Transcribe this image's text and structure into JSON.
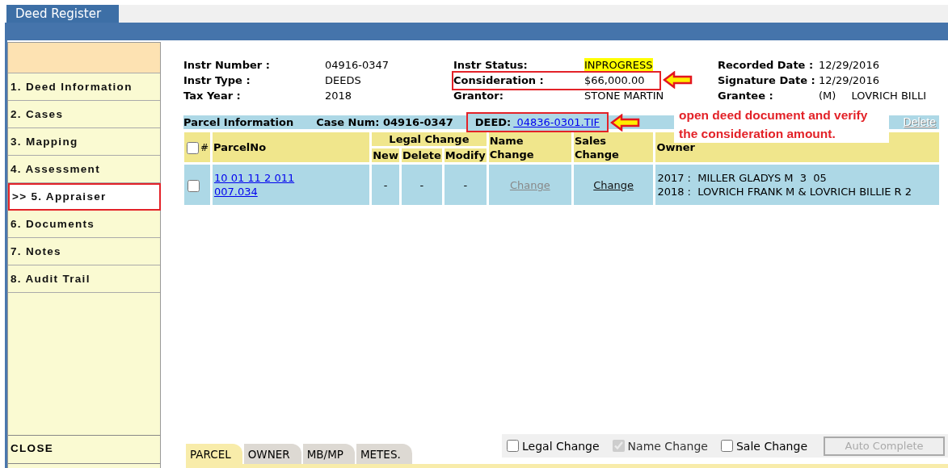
{
  "window": {
    "title": "Deed Register"
  },
  "sidebar": {
    "items": [
      {
        "label": "1. Deed Information",
        "selected": false
      },
      {
        "label": "2. Cases",
        "selected": false
      },
      {
        "label": "3. Mapping",
        "selected": false
      },
      {
        "label": "4. Assessment",
        "selected": false
      },
      {
        "label": ">> 5. Appraiser",
        "selected": true
      },
      {
        "label": "6. Documents",
        "selected": false
      },
      {
        "label": "7. Notes",
        "selected": false
      },
      {
        "label": "8. Audit Trail",
        "selected": false
      }
    ],
    "close": "CLOSE"
  },
  "instrument": {
    "columns": [
      [
        {
          "label": "Instr Number :",
          "value": "04916-0347",
          "highlighted": false,
          "callout": false
        },
        {
          "label": "Instr Type :",
          "value": "DEEDS",
          "highlighted": false,
          "callout": false
        },
        {
          "label": "Tax Year :",
          "value": "2018",
          "highlighted": false,
          "callout": false
        }
      ],
      [
        {
          "label": "Instr Status:",
          "value": "INPROGRESS",
          "highlighted": true,
          "callout": false
        },
        {
          "label": "Consideration :",
          "value": "$66,000.00",
          "highlighted": false,
          "callout": true
        },
        {
          "label": "Grantor:",
          "value": "STONE MARTIN",
          "highlighted": false,
          "callout": false
        }
      ],
      [
        {
          "label": "Recorded Date :",
          "value": "12/29/2016",
          "highlighted": false,
          "callout": false
        },
        {
          "label": "Signature Date :",
          "value": "12/29/2016",
          "highlighted": false,
          "callout": false
        },
        {
          "label": "Grantee :",
          "prefix": "(M)",
          "value": "LOVRICH BILLI",
          "highlighted": false,
          "callout": false
        }
      ]
    ]
  },
  "parcel_bar": {
    "title": "Parcel Information",
    "case_num": "Case Num: 04916-0347",
    "deed_label": "DEED:",
    "deed_link": "04836-0301.TIF",
    "deed_callout": true,
    "note": "open deed document and verify the consideration amount.",
    "delete": {
      "label": "Delete",
      "disabled": true
    }
  },
  "table": {
    "select_all": {
      "checked": false
    },
    "header": {
      "number": "#",
      "parcel": "ParcelNo",
      "legal_change": {
        "label": "Legal Change",
        "sub": [
          "New",
          "Delete",
          "Modify"
        ]
      },
      "name_change": "Name Change",
      "sales_change": "Sales Change",
      "owner": "Owner"
    },
    "rows": [
      {
        "checked": false,
        "parcel_no": "10 01 11 2 011 007.034",
        "legal": [
          "-",
          "-",
          "-"
        ],
        "name_change": {
          "label": "Change",
          "disabled": true
        },
        "sales_change": {
          "label": "Change",
          "disabled": false
        },
        "owner": [
          "2017 :  MILLER GLADYS M  3  05",
          "2018 :  LOVRICH FRANK M & LOVRICH BILLIE R 2"
        ]
      }
    ]
  },
  "bottom": {
    "tabs": [
      {
        "label": "PARCEL",
        "selected": true
      },
      {
        "label": "OWNER",
        "selected": false
      },
      {
        "label": "MB/MP",
        "selected": false
      },
      {
        "label": "METES.",
        "selected": false
      }
    ],
    "options": [
      {
        "label": "Legal Change",
        "checked": false,
        "disabled": false
      },
      {
        "label": "Name Change",
        "checked": true,
        "disabled": true
      },
      {
        "label": "Sale Change",
        "checked": false,
        "disabled": false
      }
    ],
    "auto_complete": {
      "label": "Auto Complete",
      "disabled": true
    }
  }
}
